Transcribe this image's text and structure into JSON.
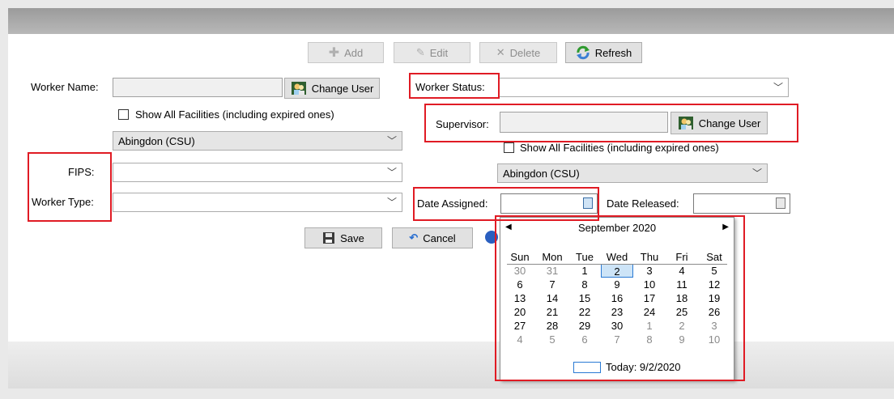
{
  "toolbar": {
    "add": "Add",
    "edit": "Edit",
    "delete": "Delete",
    "refresh": "Refresh"
  },
  "left": {
    "worker_name_label": "Worker Name:",
    "worker_name_value": "",
    "change_user_label": "Change User",
    "show_all_label": "Show All Facilities (including expired ones)",
    "facility_value": "Abingdon (CSU)",
    "fips_label": "FIPS:",
    "fips_value": "",
    "worker_type_label": "Worker Type:",
    "worker_type_value": ""
  },
  "right": {
    "worker_status_label": "Worker Status:",
    "worker_status_value": "",
    "supervisor_label": "Supervisor:",
    "supervisor_value": "",
    "change_user_label": "Change User",
    "show_all_label": "Show All Facilities (including expired ones)",
    "facility_value": "Abingdon (CSU)",
    "date_assigned_label": "Date Assigned:",
    "date_assigned_value": "",
    "date_released_label": "Date Released:",
    "date_released_value": ""
  },
  "actions": {
    "save": "Save",
    "cancel": "Cancel"
  },
  "calendar": {
    "month_label": "September 2020",
    "weekdays": [
      "Sun",
      "Mon",
      "Tue",
      "Wed",
      "Thu",
      "Fri",
      "Sat"
    ],
    "weeks": [
      [
        "30",
        "31",
        "1",
        "2",
        "3",
        "4",
        "5"
      ],
      [
        "6",
        "7",
        "8",
        "9",
        "10",
        "11",
        "12"
      ],
      [
        "13",
        "14",
        "15",
        "16",
        "17",
        "18",
        "19"
      ],
      [
        "20",
        "21",
        "22",
        "23",
        "24",
        "25",
        "26"
      ],
      [
        "27",
        "28",
        "29",
        "30",
        "1",
        "2",
        "3"
      ],
      [
        "4",
        "5",
        "6",
        "7",
        "8",
        "9",
        "10"
      ]
    ],
    "selected_day": "2",
    "today_label": "Today: 9/2/2020"
  },
  "colors": {
    "highlight": "#e01b24",
    "selection": "#2a7ad4"
  }
}
